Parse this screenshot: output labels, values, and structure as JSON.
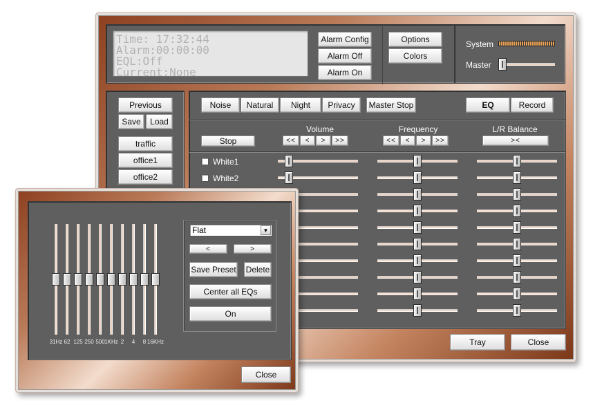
{
  "lcd": {
    "lines": [
      "Time: 17:32:44",
      "Alarm:00:00:00",
      "EQL:Off",
      "Current:None"
    ]
  },
  "alarm": {
    "config": "Alarm Config",
    "off": "Alarm Off",
    "on": "Alarm On"
  },
  "options": {
    "options": "Options",
    "colors": "Colors"
  },
  "levels": {
    "system_label": "System",
    "master_label": "Master",
    "master_level": 0.0
  },
  "left": {
    "previous": "Previous",
    "save": "Save",
    "load": "Load",
    "presets": [
      "traffic",
      "office1",
      "office2"
    ]
  },
  "toolbar": {
    "noise": "Noise",
    "natural": "Natural",
    "night": "Night",
    "privacy": "Privacy",
    "master_stop": "Master Stop",
    "eq": "EQ",
    "record": "Record"
  },
  "columns": {
    "stop": "Stop",
    "volume": "Volume",
    "frequency": "Frequency",
    "balance": "L/R Balance",
    "nav": [
      "<<",
      "<",
      ">",
      ">>"
    ],
    "balance_center": "><"
  },
  "channels": [
    {
      "name": "White1",
      "volume": 0.1,
      "frequency": 0.5,
      "balance": 0.5
    },
    {
      "name": "White2",
      "volume": 0.1,
      "frequency": 0.5,
      "balance": 0.5
    },
    {
      "name": "",
      "volume": 0.1,
      "frequency": 0.5,
      "balance": 0.5
    },
    {
      "name": "",
      "volume": 0.1,
      "frequency": 0.5,
      "balance": 0.5
    },
    {
      "name": "",
      "volume": 0.1,
      "frequency": 0.5,
      "balance": 0.5
    },
    {
      "name": "",
      "volume": 0.1,
      "frequency": 0.5,
      "balance": 0.5
    },
    {
      "name": "",
      "volume": 0.1,
      "frequency": 0.5,
      "balance": 0.5
    },
    {
      "name": "",
      "volume": 0.1,
      "frequency": 0.5,
      "balance": 0.5
    },
    {
      "name": "",
      "volume": 0.1,
      "frequency": 0.5,
      "balance": 0.5
    },
    {
      "name": "",
      "volume": 0.1,
      "frequency": 0.5,
      "balance": 0.5
    }
  ],
  "footer": {
    "tray": "Tray",
    "close": "Close"
  },
  "eq": {
    "bands": [
      {
        "label": "31Hz",
        "level": 0.5
      },
      {
        "label": "62",
        "level": 0.5
      },
      {
        "label": "125",
        "level": 0.5
      },
      {
        "label": "250",
        "level": 0.5
      },
      {
        "label": "500",
        "level": 0.5
      },
      {
        "label": "1KHz",
        "level": 0.5
      },
      {
        "label": "2",
        "level": 0.5
      },
      {
        "label": "4",
        "level": 0.5
      },
      {
        "label": "8",
        "level": 0.5
      },
      {
        "label": "16KHz",
        "level": 0.5
      }
    ],
    "preset_value": "Flat",
    "prev": "<",
    "next": ">",
    "save_preset": "Save Preset",
    "delete": "Delete",
    "center": "Center all EQs",
    "on": "On",
    "close": "Close"
  },
  "colors": {
    "panel": "#5f5f5f",
    "accent": "#b97a58"
  }
}
